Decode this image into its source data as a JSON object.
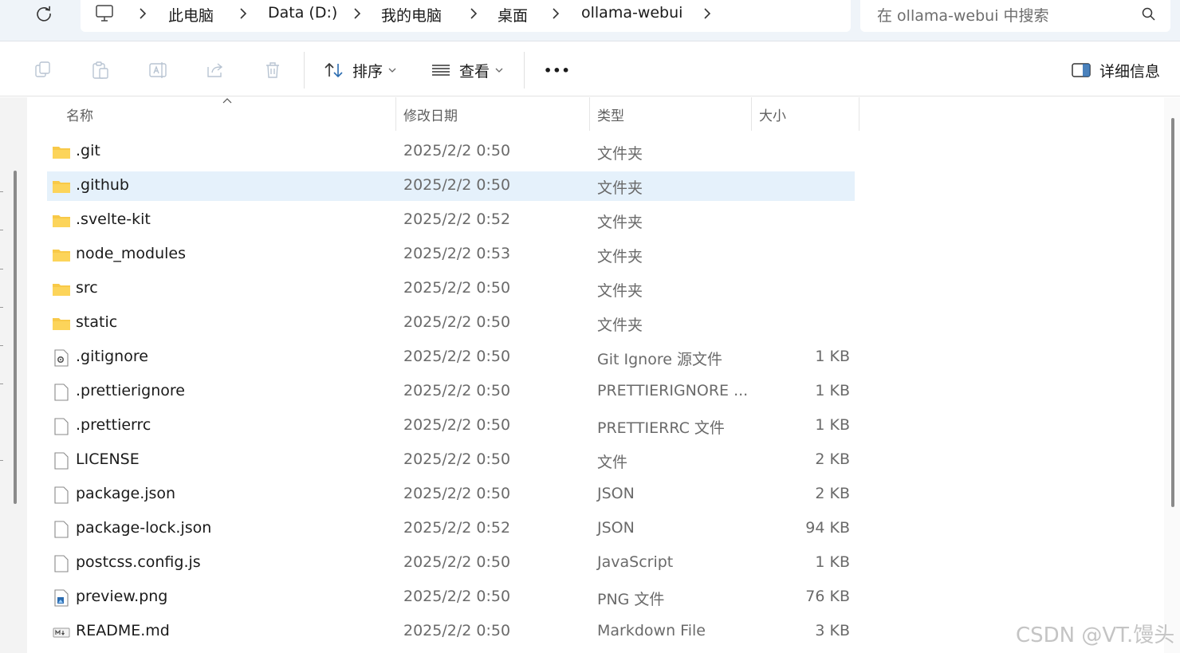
{
  "address_bar": {
    "refresh_icon": "refresh-icon",
    "pc_icon": "monitor-icon",
    "breadcrumbs": [
      "此电脑",
      "Data (D:)",
      "我的电脑",
      "桌面",
      "ollama-webui"
    ],
    "search_placeholder": "在 ollama-webui 中搜索"
  },
  "toolbar": {
    "icons": [
      "copy-icon",
      "paste-icon",
      "rename-icon",
      "share-icon",
      "delete-icon"
    ],
    "sort_label": "排序",
    "view_label": "查看",
    "more_label": "•••",
    "details_label": "详细信息"
  },
  "columns": {
    "name": "名称",
    "date": "修改日期",
    "type": "类型",
    "size": "大小"
  },
  "files": [
    {
      "name": ".git",
      "date": "2025/2/2 0:50",
      "type": "文件夹",
      "size": "",
      "icon": "folder-icon"
    },
    {
      "name": ".github",
      "date": "2025/2/2 0:50",
      "type": "文件夹",
      "size": "",
      "icon": "folder-icon",
      "selected": true
    },
    {
      "name": ".svelte-kit",
      "date": "2025/2/2 0:52",
      "type": "文件夹",
      "size": "",
      "icon": "folder-icon"
    },
    {
      "name": "node_modules",
      "date": "2025/2/2 0:53",
      "type": "文件夹",
      "size": "",
      "icon": "folder-icon"
    },
    {
      "name": "src",
      "date": "2025/2/2 0:50",
      "type": "文件夹",
      "size": "",
      "icon": "folder-icon"
    },
    {
      "name": "static",
      "date": "2025/2/2 0:50",
      "type": "文件夹",
      "size": "",
      "icon": "folder-icon"
    },
    {
      "name": ".gitignore",
      "date": "2025/2/2 0:50",
      "type": "Git Ignore 源文件",
      "size": "1 KB",
      "icon": "settings-file-icon"
    },
    {
      "name": ".prettierignore",
      "date": "2025/2/2 0:50",
      "type": "PRETTIERIGNORE ...",
      "size": "1 KB",
      "icon": "file-icon"
    },
    {
      "name": ".prettierrc",
      "date": "2025/2/2 0:50",
      "type": "PRETTIERRC 文件",
      "size": "1 KB",
      "icon": "file-icon"
    },
    {
      "name": "LICENSE",
      "date": "2025/2/2 0:50",
      "type": "文件",
      "size": "2 KB",
      "icon": "file-icon"
    },
    {
      "name": "package.json",
      "date": "2025/2/2 0:50",
      "type": "JSON",
      "size": "2 KB",
      "icon": "file-icon"
    },
    {
      "name": "package-lock.json",
      "date": "2025/2/2 0:52",
      "type": "JSON",
      "size": "94 KB",
      "icon": "file-icon"
    },
    {
      "name": "postcss.config.js",
      "date": "2025/2/2 0:50",
      "type": "JavaScript",
      "size": "1 KB",
      "icon": "file-icon"
    },
    {
      "name": "preview.png",
      "date": "2025/2/2 0:50",
      "type": "PNG 文件",
      "size": "76 KB",
      "icon": "image-file-icon"
    },
    {
      "name": "README.md",
      "date": "2025/2/2 0:50",
      "type": "Markdown File",
      "size": "3 KB",
      "icon": "markdown-file-icon"
    }
  ],
  "watermark": "CSDN @VT.馒头",
  "colors": {
    "selection": "#e5f1fb",
    "folder": "#f8c948",
    "chrome": "#eff4f9",
    "accent": "#1a73c8"
  }
}
